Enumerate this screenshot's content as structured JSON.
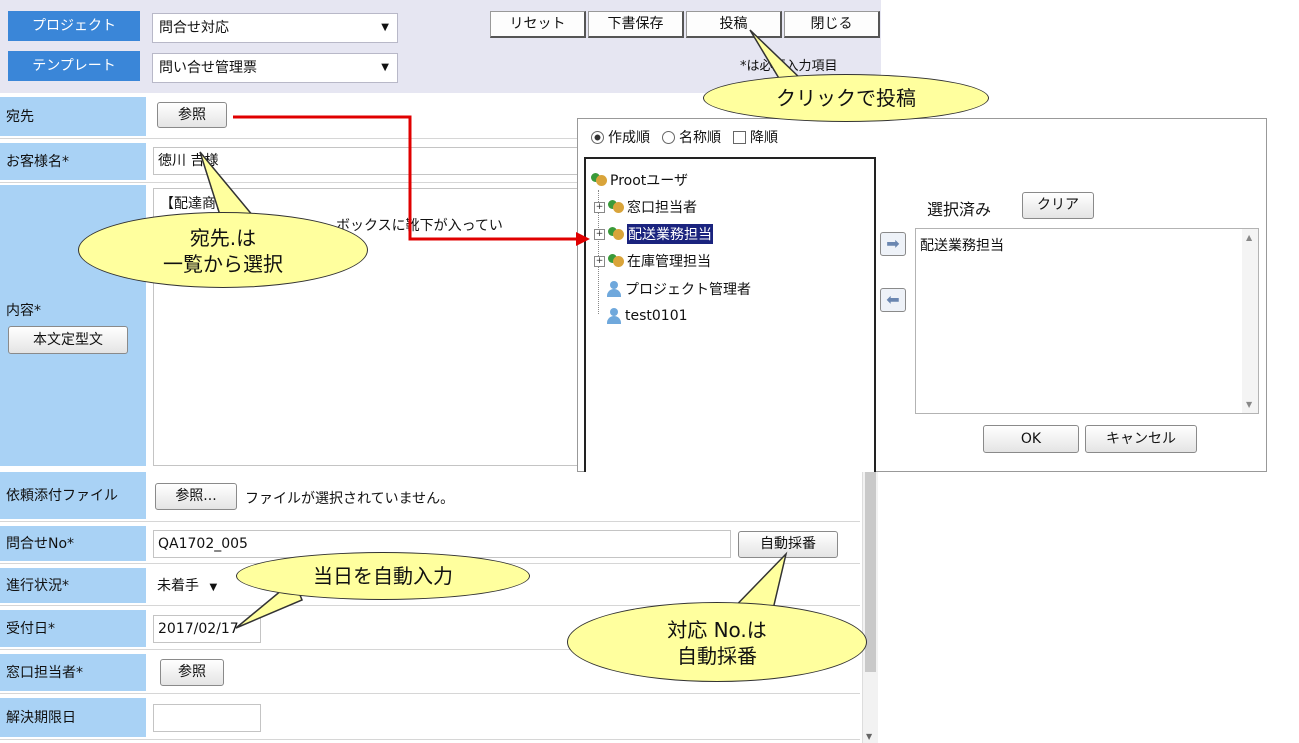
{
  "header": {
    "project_label": "プロジェクト",
    "project_value": "問合せ対応",
    "template_label": "テンプレート",
    "template_value": "問い合せ管理票",
    "required_note": "*は必須入力項目",
    "toolbar": {
      "reset": "リセット",
      "draft_save": "下書保存",
      "post": "投稿",
      "close": "閉じる"
    }
  },
  "form": {
    "recipient_label": "宛先",
    "recipient_browse": "参照",
    "customer_label": "お客様名*",
    "customer_value": "徳川 吉様",
    "content_label": "内容*",
    "template_button": "本文定型文",
    "content_line1": "【配達商品】",
    "content_line2": "ボックスに靴下が入ってい",
    "attach_label": "依頼添付ファイル",
    "attach_browse": "参照...",
    "attach_status": "ファイルが選択されていません。",
    "inquiry_no_label": "問合せNo*",
    "inquiry_no_value": "QA1702_005",
    "auto_number_button": "自動採番",
    "status_label": "進行状況*",
    "status_value": "未着手",
    "received_label": "受付日*",
    "received_value": "2017/02/17",
    "contact_label": "窓口担当者*",
    "contact_browse": "参照",
    "deadline_label": "解決期限日",
    "deadline_value": ""
  },
  "dialog": {
    "sort_created": "作成順",
    "sort_name": "名称順",
    "sort_desc": "降順",
    "tree": {
      "root": "Prootユーザ",
      "items": [
        "窓口担当者",
        "配送業務担当",
        "在庫管理担当",
        "プロジェクト管理者",
        "test0101"
      ]
    },
    "selected_label": "選択済み",
    "clear_button": "クリア",
    "selected_items": [
      "配送業務担当"
    ],
    "ok_button": "OK",
    "cancel_button": "キャンセル"
  },
  "callouts": {
    "post": "クリックで投稿",
    "recipient_1": "宛先.は",
    "recipient_2": "一覧から選択",
    "today": "当日を自動入力",
    "number_1": "対応 No.は",
    "number_2": "自動採番"
  },
  "colors": {
    "header_label_bg": "#3a86d8",
    "field_label_bg": "#a9d2f5",
    "toolbar_bg": "#e6e6f2",
    "callout_bg": "#ffff9e",
    "connector": "#e00000",
    "tree_selection": "#1a237e"
  }
}
